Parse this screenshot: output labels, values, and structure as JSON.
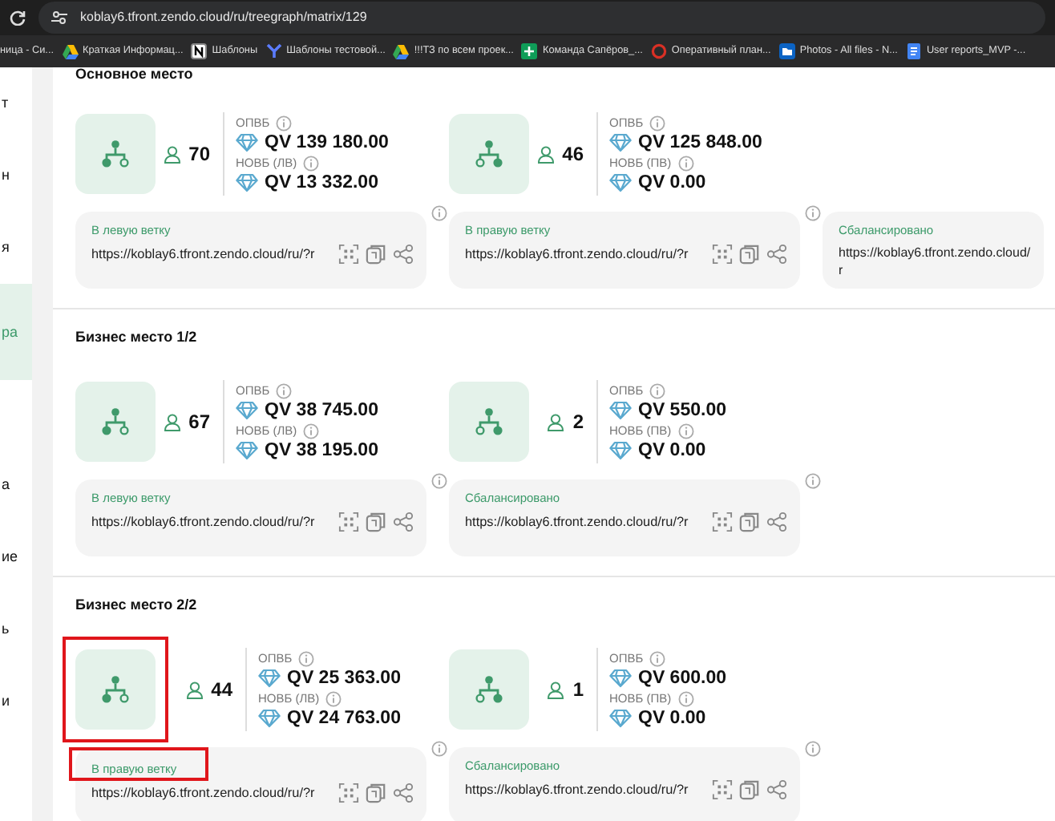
{
  "browser": {
    "url": "koblay6.tfront.zendo.cloud/ru/treegraph/matrix/129",
    "bookmarks": [
      {
        "kind": "none",
        "label": "ница - Си..."
      },
      {
        "kind": "drive",
        "label": "Краткая Информац..."
      },
      {
        "kind": "notion",
        "label": "Шаблоны"
      },
      {
        "kind": "y",
        "label": "Шаблоны тестовой..."
      },
      {
        "kind": "drive",
        "label": "!!!ТЗ по всем проек..."
      },
      {
        "kind": "sheets",
        "label": "Команда Сапёров_..."
      },
      {
        "kind": "ring",
        "label": "Оперативный план..."
      },
      {
        "kind": "folder",
        "label": "Photos - All files - N..."
      },
      {
        "kind": "docs",
        "label": "User reports_MVP -..."
      }
    ]
  },
  "sidebar": {
    "groups": [
      [
        {
          "text": "т",
          "selected": false
        },
        {
          "text": "н",
          "selected": false
        },
        {
          "text": "я",
          "selected": false
        },
        {
          "text": "ра",
          "selected": true
        }
      ],
      [
        {
          "text": "а",
          "selected": false
        },
        {
          "text": "ие",
          "selected": false
        },
        {
          "text": "ь",
          "selected": false
        },
        {
          "text": "и",
          "selected": false
        }
      ]
    ]
  },
  "sections": [
    {
      "title": "Основное место",
      "cards": [
        {
          "kind": "left",
          "count": "70",
          "opvb_label": "ОПВБ",
          "opvb": "QV 139 180.00",
          "novb_label": "НОВБ (ЛВ)",
          "novb": "QV 13 332.00",
          "highlighted": false
        },
        {
          "kind": "right",
          "count": "46",
          "opvb_label": "ОПВБ",
          "opvb": "QV 125 848.00",
          "novb_label": "НОВБ (ПВ)",
          "novb": "QV 0.00",
          "highlighted": false
        }
      ],
      "links": [
        {
          "label": "В левую ветку",
          "url": "https://koblay6.tfront.zendo.cloud/ru/?r",
          "actions": true,
          "highlighted": false
        },
        {
          "label": "В правую ветку",
          "url": "https://koblay6.tfront.zendo.cloud/ru/?r",
          "actions": true,
          "highlighted": false
        },
        {
          "label": "Сбалансировано",
          "url": "https://koblay6.tfront.zendo.cloud/r",
          "actions": false,
          "highlighted": false
        }
      ]
    },
    {
      "title": "Бизнес место 1/2",
      "cards": [
        {
          "kind": "left",
          "count": "67",
          "opvb_label": "ОПВБ",
          "opvb": "QV 38 745.00",
          "novb_label": "НОВБ (ЛВ)",
          "novb": "QV 38 195.00",
          "highlighted": false
        },
        {
          "kind": "right",
          "count": "2",
          "opvb_label": "ОПВБ",
          "opvb": "QV 550.00",
          "novb_label": "НОВБ (ПВ)",
          "novb": "QV 0.00",
          "highlighted": false
        }
      ],
      "links": [
        {
          "label": "В левую ветку",
          "url": "https://koblay6.tfront.zendo.cloud/ru/?r",
          "actions": true,
          "highlighted": false
        },
        {
          "label": "Сбалансировано",
          "url": "https://koblay6.tfront.zendo.cloud/ru/?r",
          "actions": true,
          "highlighted": false
        }
      ]
    },
    {
      "title": "Бизнес место 2/2",
      "cards": [
        {
          "kind": "left",
          "count": "44",
          "opvb_label": "ОПВБ",
          "opvb": "QV 25 363.00",
          "novb_label": "НОВБ (ЛВ)",
          "novb": "QV 24 763.00",
          "highlighted": true
        },
        {
          "kind": "right",
          "count": "1",
          "opvb_label": "ОПВБ",
          "opvb": "QV 600.00",
          "novb_label": "НОВБ (ПВ)",
          "novb": "QV 0.00",
          "highlighted": false
        }
      ],
      "links": [
        {
          "label": "В правую ветку",
          "url": "https://koblay6.tfront.zendo.cloud/ru/?r",
          "actions": true,
          "highlighted": true
        },
        {
          "label": "Сбалансировано",
          "url": "https://koblay6.tfront.zendo.cloud/ru/?r",
          "actions": true,
          "highlighted": false
        }
      ]
    }
  ]
}
